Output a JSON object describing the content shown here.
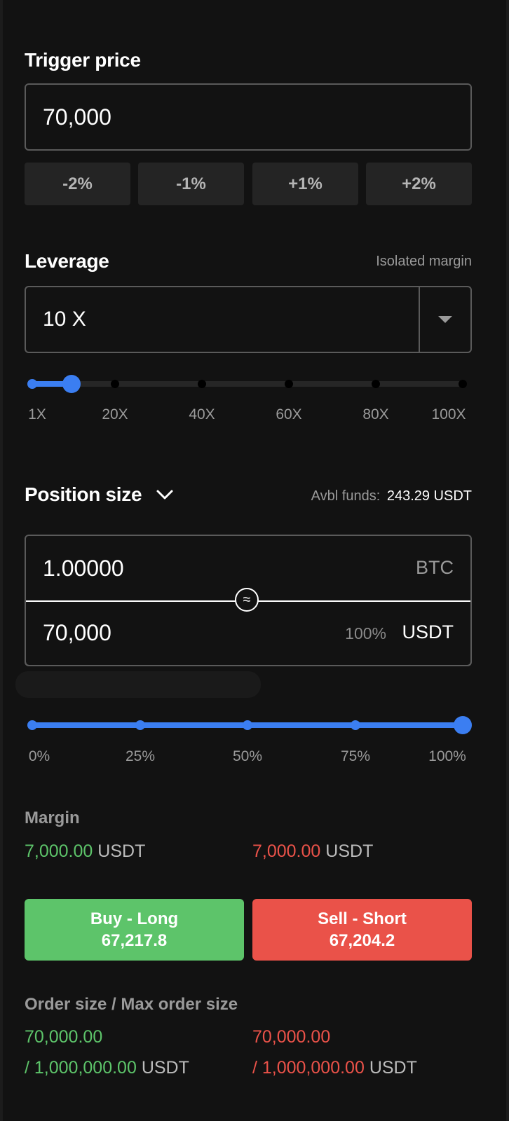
{
  "trigger": {
    "title": "Trigger price",
    "value": "70,000",
    "buttons": [
      "-2%",
      "-1%",
      "+1%",
      "+2%"
    ]
  },
  "leverage": {
    "title": "Leverage",
    "mode": "Isolated margin",
    "value": "10 X",
    "slider_value": 10,
    "ticks": [
      "1X",
      "20X",
      "40X",
      "60X",
      "80X",
      "100X"
    ]
  },
  "position": {
    "title": "Position size",
    "avbl_label": "Avbl funds:",
    "avbl_value": "243.29 USDT",
    "qty_value": "1.00000",
    "qty_unit": "BTC",
    "approx_symbol": "≈",
    "notional_value": "70,000",
    "notional_percent": "100%",
    "notional_unit": "USDT",
    "slider_percent": 100,
    "ticks": [
      "0%",
      "25%",
      "50%",
      "75%",
      "100%"
    ]
  },
  "margin": {
    "title": "Margin",
    "long_value": "7,000.00",
    "short_value": "7,000.00",
    "unit": "USDT"
  },
  "buttons": {
    "buy_label": "Buy - Long",
    "buy_price": "67,217.8",
    "sell_label": "Sell - Short",
    "sell_price": "67,204.2"
  },
  "order_size": {
    "title": "Order size / Max order size",
    "long_value": "70,000.00",
    "long_max": "/ 1,000,000.00",
    "short_value": "70,000.00",
    "short_max": "/ 1,000,000.00",
    "unit": "USDT"
  },
  "colors": {
    "accent": "#3b7ef1",
    "long": "#5dc46a",
    "short": "#ea5249",
    "background": "#121212"
  }
}
